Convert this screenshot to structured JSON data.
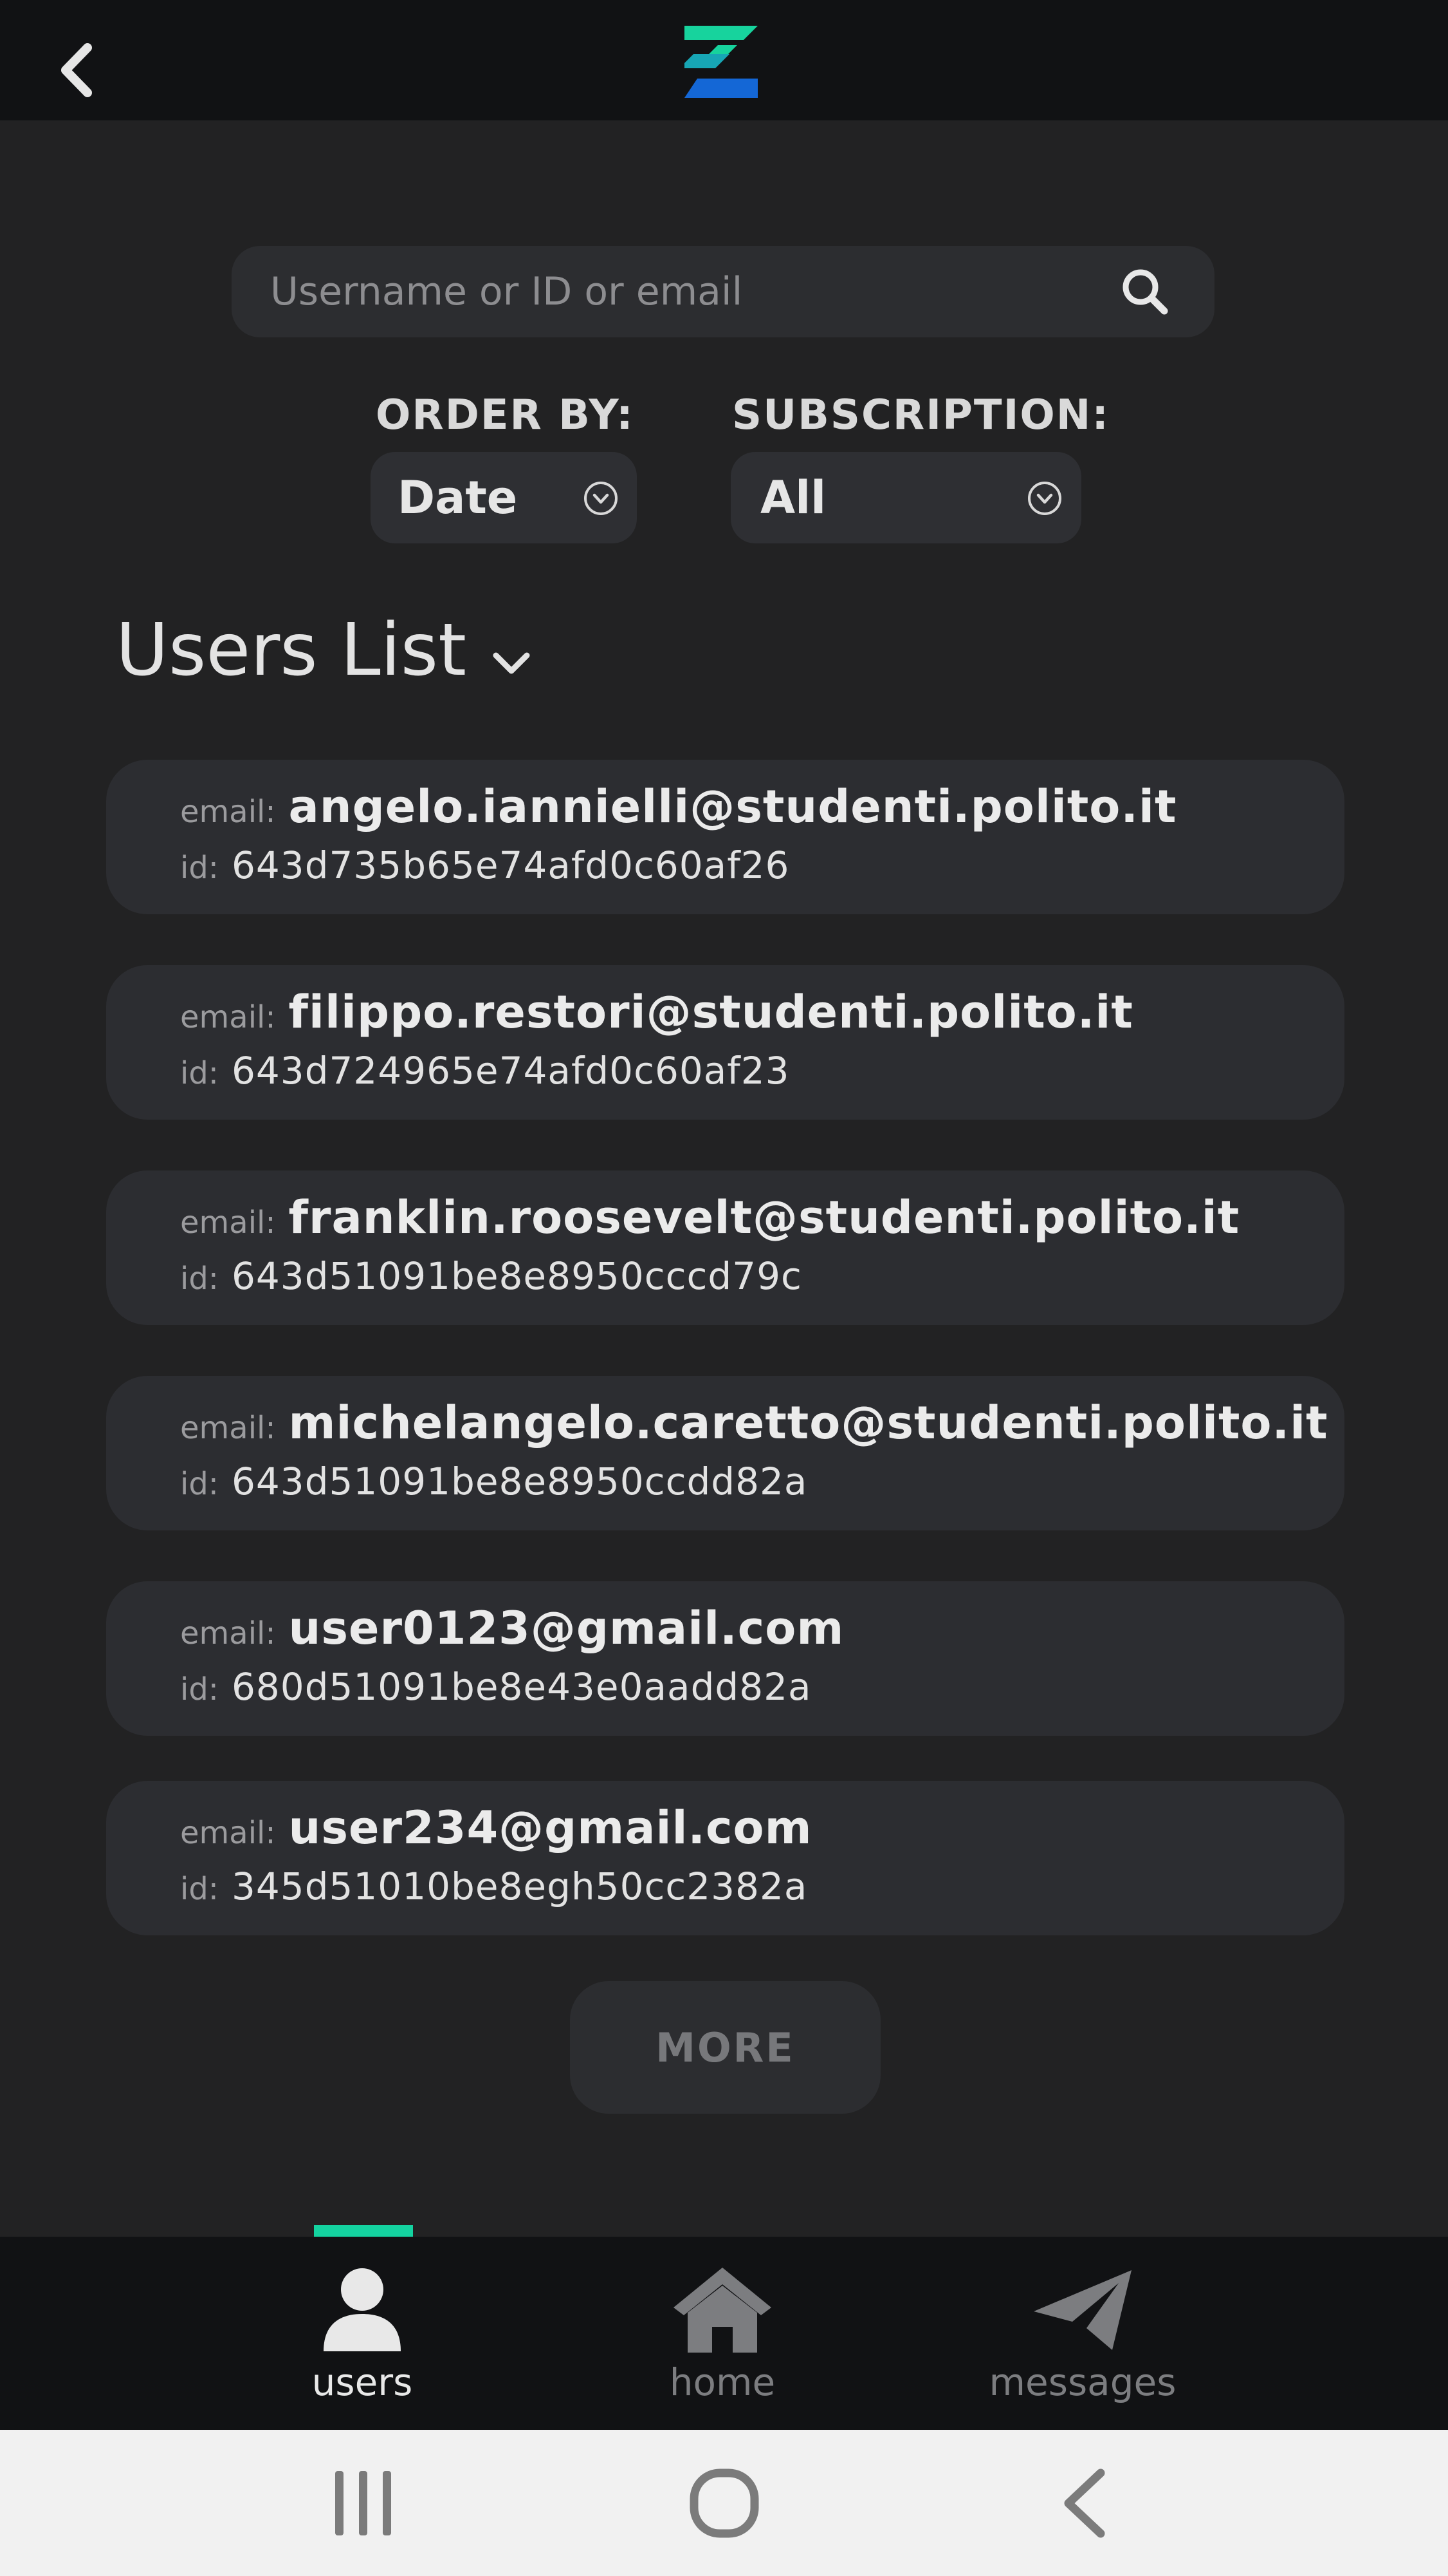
{
  "search": {
    "placeholder": "Username or ID or email",
    "value": ""
  },
  "filters": {
    "order_by": {
      "label": "ORDER BY:",
      "selected": "Date"
    },
    "subscription": {
      "label": "SUBSCRIPTION:",
      "selected": "All"
    }
  },
  "list": {
    "title": "Users List",
    "email_label": "email:",
    "id_label": "id:",
    "users": [
      {
        "email": "angelo.iannielli@studenti.polito.it",
        "id": "643d735b65e74afd0c60af26"
      },
      {
        "email": "filippo.restori@studenti.polito.it",
        "id": "643d724965e74afd0c60af23"
      },
      {
        "email": "franklin.roosevelt@studenti.polito.it",
        "id": "643d51091be8e8950cccd79c"
      },
      {
        "email": "michelangelo.caretto@studenti.polito.it",
        "id": "643d51091be8e8950ccdd82a"
      },
      {
        "email": "user0123@gmail.com",
        "id": "680d51091be8e43e0aadd82a"
      },
      {
        "email": "user234@gmail.com",
        "id": "345d51010be8egh50cc2382a"
      }
    ],
    "more_label": "MORE"
  },
  "nav": {
    "active": "users",
    "items": [
      {
        "label": "users",
        "icon": "user-icon"
      },
      {
        "label": "home",
        "icon": "home-icon"
      },
      {
        "label": "messages",
        "icon": "paper-plane-icon"
      }
    ]
  },
  "colors": {
    "accent": "#14d3a0",
    "logo_green": "#17d39d",
    "logo_blue": "#1467d6",
    "background": "#222223",
    "card": "#2c2d31"
  }
}
